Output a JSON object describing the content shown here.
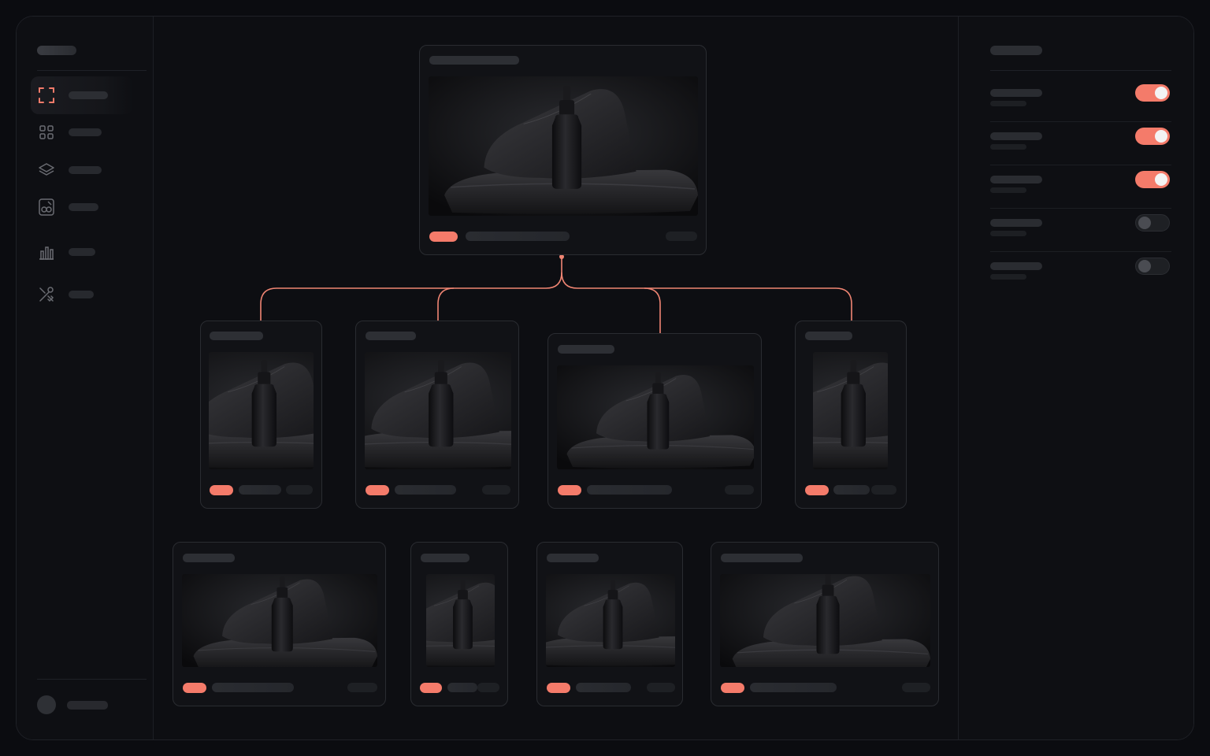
{
  "app": {
    "accent_color": "#f47b6a",
    "background": "#0d0e12"
  },
  "sidebar": {
    "items": [
      {
        "icon": "frame-select-icon",
        "active": true
      },
      {
        "icon": "grid-icon",
        "active": false
      },
      {
        "icon": "layers-icon",
        "active": false
      },
      {
        "icon": "assets-icon",
        "active": false
      },
      {
        "icon": "bar-chart-icon",
        "active": false
      },
      {
        "icon": "tools-icon",
        "active": false
      }
    ],
    "user": {
      "icon": "avatar"
    }
  },
  "canvas": {
    "root_card": {
      "thumbnail": "dropper-bottle-on-rock",
      "status": "accent"
    },
    "level_1_cards": [
      {
        "thumbnail": "dropper-bottle-on-rock"
      },
      {
        "thumbnail": "dropper-bottle-on-rock"
      },
      {
        "thumbnail": "dropper-bottle-on-rock"
      },
      {
        "thumbnail": "dropper-bottle-on-rock"
      }
    ],
    "level_2_cards": [
      {
        "thumbnail": "dropper-bottle-on-rock"
      },
      {
        "thumbnail": "dropper-bottle-on-rock"
      },
      {
        "thumbnail": "dropper-bottle-on-rock"
      },
      {
        "thumbnail": "dropper-bottle-on-rock"
      }
    ]
  },
  "settings_panel": {
    "toggles": [
      {
        "state": "on"
      },
      {
        "state": "on"
      },
      {
        "state": "on"
      },
      {
        "state": "off"
      },
      {
        "state": "off"
      }
    ]
  }
}
